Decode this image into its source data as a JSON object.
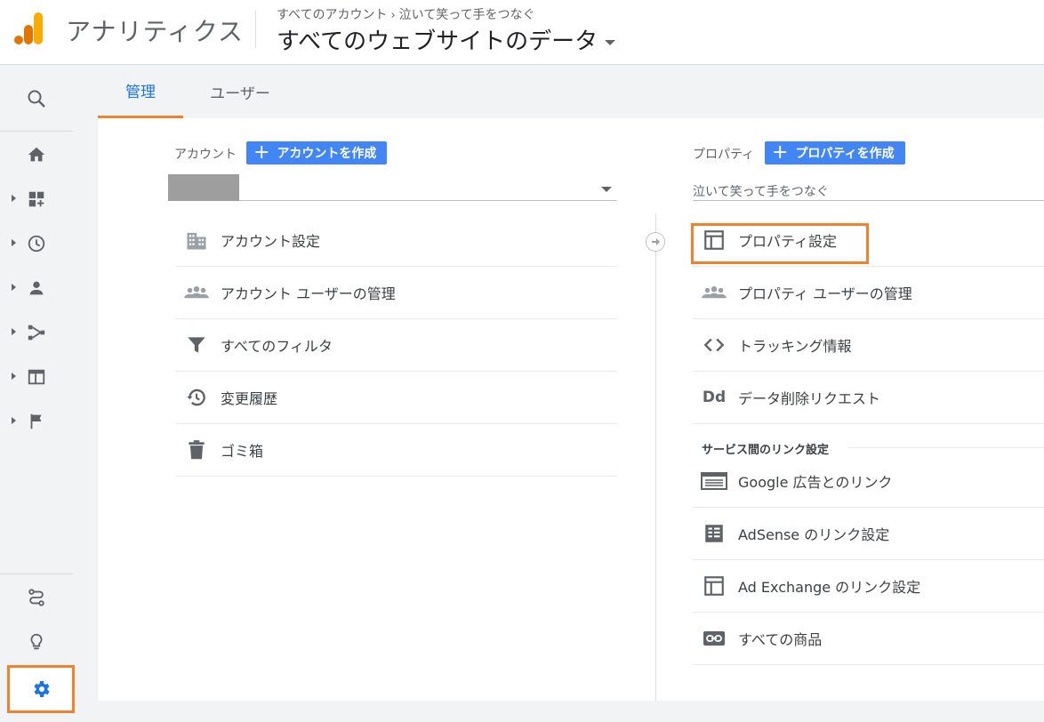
{
  "header": {
    "app_title": "アナリティクス",
    "breadcrumb": {
      "account": "すべてのアカウント",
      "property": "泣いて笑って手をつなぐ"
    },
    "view_title": "すべてのウェブサイトのデータ"
  },
  "tabs": {
    "admin": "管理",
    "user": "ユーザー"
  },
  "account_col": {
    "label": "アカウント",
    "create_label": "アカウントを作成",
    "items": [
      {
        "label": "アカウント設定",
        "icon": "building-icon"
      },
      {
        "label": "アカウント ユーザーの管理",
        "icon": "people-icon"
      },
      {
        "label": "すべてのフィルタ",
        "icon": "filter-icon"
      },
      {
        "label": "変更履歴",
        "icon": "history-icon"
      },
      {
        "label": "ゴミ箱",
        "icon": "trash-icon"
      }
    ]
  },
  "property_col": {
    "label": "プロパティ",
    "create_label": "プロパティを作成",
    "selected_property": "泣いて笑って手をつなぐ",
    "items": [
      {
        "label": "プロパティ設定",
        "icon": "layout-icon"
      },
      {
        "label": "プロパティ ユーザーの管理",
        "icon": "people-icon"
      },
      {
        "label": "トラッキング情報",
        "icon": "code-icon"
      },
      {
        "label": "データ削除リクエスト",
        "icon": "dd-icon"
      }
    ],
    "section_title": "サービス間のリンク設定",
    "link_items": [
      {
        "label": "Google 広告とのリンク",
        "icon": "ads-icon"
      },
      {
        "label": "AdSense のリンク設定",
        "icon": "adsense-icon"
      },
      {
        "label": "Ad Exchange のリンク設定",
        "icon": "layout-icon"
      },
      {
        "label": "すべての商品",
        "icon": "link-icon"
      }
    ]
  },
  "colors": {
    "accent": "#1a73e8",
    "highlight": "#f0822d",
    "button": "#4285f4"
  }
}
